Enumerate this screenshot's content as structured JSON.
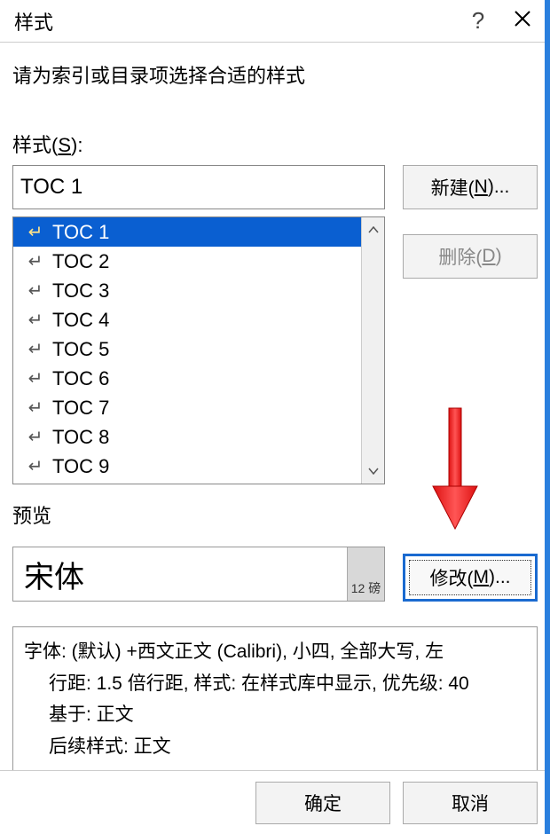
{
  "titlebar": {
    "title": "样式",
    "help": "?",
    "close_name": "close-icon"
  },
  "instruction": "请为索引或目录项选择合适的样式",
  "styles_label": {
    "pre": "样式(",
    "key": "S",
    "post": "):"
  },
  "style_input_value": "TOC 1",
  "list_items": [
    {
      "label": "TOC 1",
      "selected": true
    },
    {
      "label": "TOC 2",
      "selected": false
    },
    {
      "label": "TOC 3",
      "selected": false
    },
    {
      "label": "TOC 4",
      "selected": false
    },
    {
      "label": "TOC 5",
      "selected": false
    },
    {
      "label": "TOC 6",
      "selected": false
    },
    {
      "label": "TOC 7",
      "selected": false
    },
    {
      "label": "TOC 8",
      "selected": false
    },
    {
      "label": "TOC 9",
      "selected": false
    }
  ],
  "buttons": {
    "new": {
      "pre": "新建(",
      "key": "N",
      "post": ")..."
    },
    "delete": {
      "pre": "删除(",
      "key": "D",
      "post": ")"
    },
    "modify": {
      "pre": "修改(",
      "key": "M",
      "post": ")..."
    },
    "ok": "确定",
    "cancel": "取消"
  },
  "preview": {
    "label": "预览",
    "text": "宋体",
    "size": "12 磅"
  },
  "description": {
    "l1": "字体: (默认) +西文正文 (Calibri), 小四, 全部大写, 左",
    "l2": "行距: 1.5 倍行距, 样式: 在样式库中显示, 优先级: 40",
    "l3": "基于: 正文",
    "l4": "后续样式: 正文"
  }
}
